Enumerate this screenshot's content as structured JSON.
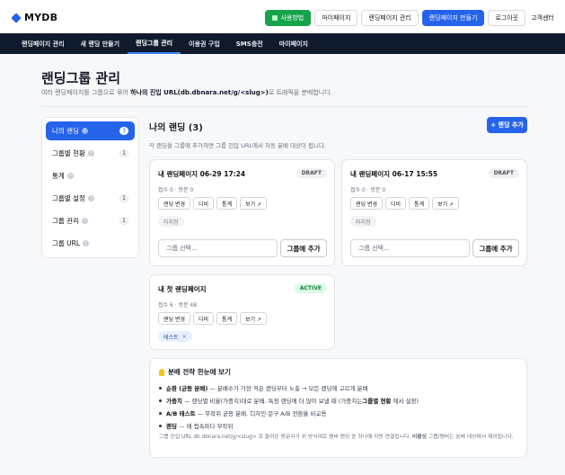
{
  "brand": {
    "name": "MYDB"
  },
  "header": {
    "guide_label": "사용방법",
    "mypage_label": "마이페이지",
    "landing_manage_label": "랜딩페이지 관리",
    "create_landing_label": "랜딩페이지 만들기",
    "logout_label": "로그아웃",
    "support_label": "고객센터"
  },
  "nav": {
    "items": [
      "랜딩페이지 관리",
      "새 랜딩 만들기",
      "랜딩그룹 관리",
      "이용권 구입",
      "SMS충전",
      "마이페이지"
    ],
    "active_index": 2
  },
  "page": {
    "title": "랜딩그룹 관리",
    "subtitle_prefix": "여러 랜딩페이지를 그룹으로 묶어 ",
    "subtitle_bold": "하나의 진입 URL(db.dbnara.net/g/<slug>)",
    "subtitle_suffix": "로 트래픽을 분배합니다."
  },
  "sidebar": {
    "items": [
      {
        "label": "나의 랜딩",
        "count": "3",
        "help": true
      },
      {
        "label": "그룹별 현황",
        "count": "1",
        "help": true
      },
      {
        "label": "통계",
        "count": "",
        "help": true
      },
      {
        "label": "그룹별 설정",
        "count": "1",
        "help": true
      },
      {
        "label": "그룹 관리",
        "count": "1",
        "help": true
      },
      {
        "label": "그룹 URL",
        "count": "",
        "help": true
      }
    ],
    "help_glyph": "?"
  },
  "main": {
    "title": "나의 랜딩 (3)",
    "subtitle": "각 랜딩을 그룹에 추가하면 그룹 진입 URL에서 자동 분배 대상이 됩니다.",
    "add_button": "+ 랜딩 추가"
  },
  "cards": [
    {
      "title": "내 랜딩페이지 06-29 17:24",
      "status": "DRAFT",
      "meta": "접수 0 · 방문 0",
      "buttons": [
        "랜딩 변경",
        "디비",
        "통계",
        "보기 ↗"
      ],
      "tag": "미지정",
      "select_placeholder": "그룹 선택...",
      "group_button": "그룹에 추가"
    },
    {
      "title": "내 랜딩페이지 06-17 15:55",
      "status": "DRAFT",
      "meta": "접수 0 · 방문 0",
      "buttons": [
        "랜딩 변경",
        "디비",
        "통계",
        "보기 ↗"
      ],
      "tag": "미지정",
      "select_placeholder": "그룹 선택...",
      "group_button": "그룹에 추가"
    },
    {
      "title": "내 첫 랜딩페이지",
      "status": "ACTIVE",
      "meta": "접수 6 · 방문 48",
      "buttons": [
        "랜딩 변경",
        "디비",
        "통계",
        "보기 ↗"
      ],
      "tag": "테스트",
      "tag_remove": "×"
    }
  ],
  "info": {
    "title": "분배 전략 한눈에 보기",
    "items": [
      {
        "bold": "순환 (균등 분배)",
        "text": "— 분배수가 가장 적은 랜딩부터 노출 → 모든 랜딩에 고르게 분배"
      },
      {
        "bold": "가중치",
        "text": "— 랜딩별 비율(가중치)대로 분배. 특정 랜딩에 더 많이 보낼 때 (가중치는 ",
        "bold2": "그룹별 현황",
        "text2": "에서 설정)"
      },
      {
        "bold": "A/B 테스트",
        "text": "— 무작위 균등 분배. 디자인·문구 A/B 전환율 비교용"
      },
      {
        "bold": "랜딩",
        "text": "— 매 접속마다 무작위"
      }
    ],
    "note_prefix": "그룹 진입 URL db.dbnara.net/g/<slug> 로 들어온 방문자가 위 방식대로 멤버 랜딩 중 하나에 자동 연결됩니다. ",
    "note_bold": "비활성",
    "note_suffix": " 그룹/멤버는 분배 대상에서 제외됩니다."
  }
}
